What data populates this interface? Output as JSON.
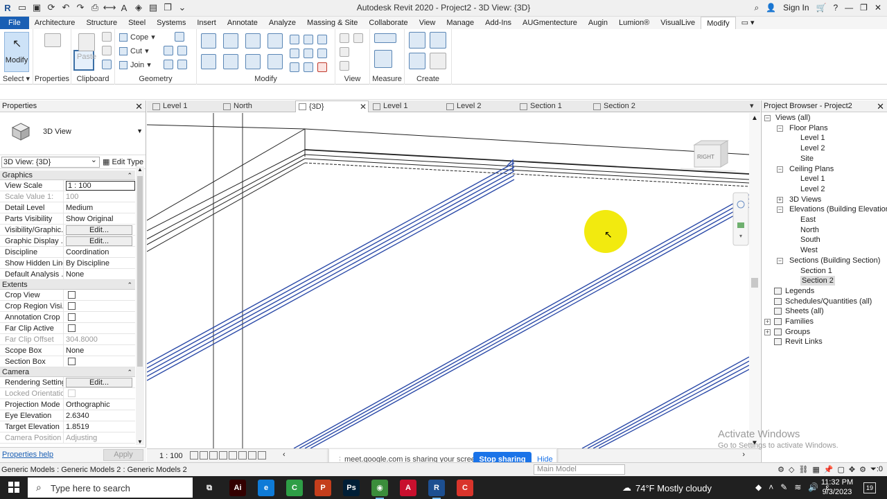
{
  "titlebar": {
    "title": "Autodesk Revit 2020 - Project2 - 3D View: {3D}",
    "sign_in": "Sign In"
  },
  "ribbon_tabs": [
    "File",
    "Architecture",
    "Structure",
    "Steel",
    "Systems",
    "Insert",
    "Annotate",
    "Analyze",
    "Massing & Site",
    "Collaborate",
    "View",
    "Manage",
    "Add-Ins",
    "AUGmentecture",
    "Augin",
    "Lumion®",
    "VisualLive",
    "Modify"
  ],
  "ribbon": {
    "modify_label": "Modify",
    "select_label": "Select",
    "properties_label": "Properties",
    "clipboard_label": "Clipboard",
    "paste_label": "Paste",
    "cope_label": "Cope",
    "cut_label": "Cut",
    "join_label": "Join",
    "geometry_label": "Geometry",
    "modify_group_label": "Modify",
    "view_label": "View",
    "measure_label": "Measure",
    "create_label": "Create"
  },
  "properties": {
    "header": "Properties",
    "type_name": "3D View",
    "selector": "3D View: {3D}",
    "edit_type": "Edit Type",
    "sections": [
      {
        "name": "Graphics",
        "rows": [
          {
            "k": "View Scale",
            "v": "1 : 100",
            "kind": "box"
          },
          {
            "k": "Scale Value    1:",
            "v": "100",
            "kind": "text",
            "disabled": true
          },
          {
            "k": "Detail Level",
            "v": "Medium",
            "kind": "text"
          },
          {
            "k": "Parts Visibility",
            "v": "Show Original",
            "kind": "text"
          },
          {
            "k": "Visibility/Graphic...",
            "v": "Edit...",
            "kind": "edit"
          },
          {
            "k": "Graphic Display ...",
            "v": "Edit...",
            "kind": "edit"
          },
          {
            "k": "Discipline",
            "v": "Coordination",
            "kind": "text"
          },
          {
            "k": "Show Hidden Lines",
            "v": "By Discipline",
            "kind": "text"
          },
          {
            "k": "Default Analysis ...",
            "v": "None",
            "kind": "text"
          }
        ]
      },
      {
        "name": "Extents",
        "rows": [
          {
            "k": "Crop View",
            "v": "",
            "kind": "check"
          },
          {
            "k": "Crop Region Visi...",
            "v": "",
            "kind": "check"
          },
          {
            "k": "Annotation Crop",
            "v": "",
            "kind": "check"
          },
          {
            "k": "Far Clip Active",
            "v": "",
            "kind": "check"
          },
          {
            "k": "Far Clip Offset",
            "v": "304.8000",
            "kind": "text",
            "disabled": true
          },
          {
            "k": "Scope Box",
            "v": "None",
            "kind": "text"
          },
          {
            "k": "Section Box",
            "v": "",
            "kind": "check"
          }
        ]
      },
      {
        "name": "Camera",
        "rows": [
          {
            "k": "Rendering Settings",
            "v": "Edit...",
            "kind": "edit"
          },
          {
            "k": "Locked Orientation",
            "v": "",
            "kind": "check",
            "disabled": true
          },
          {
            "k": "Projection Mode",
            "v": "Orthographic",
            "kind": "text"
          },
          {
            "k": "Eye Elevation",
            "v": "2.6340",
            "kind": "text"
          },
          {
            "k": "Target Elevation",
            "v": "1.8519",
            "kind": "text"
          },
          {
            "k": "Camera Position",
            "v": "Adjusting",
            "kind": "text",
            "disabled": true
          }
        ]
      }
    ],
    "help_link": "Properties help",
    "apply": "Apply"
  },
  "view_tabs": [
    {
      "label": "Level 1",
      "active": false
    },
    {
      "label": "North",
      "active": false
    },
    {
      "label": "{3D}",
      "active": true
    },
    {
      "label": "Level 1",
      "active": false
    },
    {
      "label": "Level 2",
      "active": false
    },
    {
      "label": "Section 1",
      "active": false
    },
    {
      "label": "Section 2",
      "active": false
    }
  ],
  "viewcube_label": "RIGHT",
  "view_bar": {
    "scale": "1 : 100"
  },
  "share_bar": {
    "message": "meet.google.com is sharing your screen.",
    "stop": "Stop sharing",
    "hide": "Hide"
  },
  "project_browser": {
    "header": "Project Browser - Project2",
    "nodes": [
      {
        "label": "Views (all)",
        "level": 0,
        "toggle": "-"
      },
      {
        "label": "Floor Plans",
        "level": 1,
        "toggle": "-"
      },
      {
        "label": "Level 1",
        "level": 2
      },
      {
        "label": "Level 2",
        "level": 2
      },
      {
        "label": "Site",
        "level": 2
      },
      {
        "label": "Ceiling Plans",
        "level": 1,
        "toggle": "-"
      },
      {
        "label": "Level 1",
        "level": 2
      },
      {
        "label": "Level 2",
        "level": 2
      },
      {
        "label": "3D Views",
        "level": 1,
        "toggle": "+"
      },
      {
        "label": "Elevations (Building Elevation)",
        "level": 1,
        "toggle": "-"
      },
      {
        "label": "East",
        "level": 2
      },
      {
        "label": "North",
        "level": 2
      },
      {
        "label": "South",
        "level": 2
      },
      {
        "label": "West",
        "level": 2
      },
      {
        "label": "Sections (Building Section)",
        "level": 1,
        "toggle": "-"
      },
      {
        "label": "Section 1",
        "level": 2
      },
      {
        "label": "Section 2",
        "level": 2,
        "selected": true
      },
      {
        "label": "Legends",
        "level": 0,
        "icon": true
      },
      {
        "label": "Schedules/Quantities (all)",
        "level": 0,
        "icon": true
      },
      {
        "label": "Sheets (all)",
        "level": 0,
        "icon": true
      },
      {
        "label": "Families",
        "level": 0,
        "toggle": "+",
        "icon": true
      },
      {
        "label": "Groups",
        "level": 0,
        "toggle": "+",
        "icon": true
      },
      {
        "label": "Revit Links",
        "level": 0,
        "icon": true
      }
    ]
  },
  "watermark": {
    "line1": "Activate Windows",
    "line2": "Go to Settings to activate Windows."
  },
  "status_bar": {
    "text": "Generic Models : Generic Models 2 : Generic Models 2",
    "model": "Main Model",
    "filter_count": ":0"
  },
  "taskbar": {
    "search_placeholder": "Type here to search",
    "apps": [
      {
        "name": "task-view",
        "label": "⧉",
        "color": "#202020"
      },
      {
        "name": "illustrator",
        "label": "Ai",
        "color": "#330000"
      },
      {
        "name": "edge",
        "label": "e",
        "color": "#0f7bd7"
      },
      {
        "name": "camtasia",
        "label": "C",
        "color": "#2e9e46"
      },
      {
        "name": "powerpoint",
        "label": "P",
        "color": "#c43e1c"
      },
      {
        "name": "photoshop",
        "label": "Ps",
        "color": "#001e36"
      },
      {
        "name": "chrome",
        "label": "◉",
        "color": "#3b8d3b"
      },
      {
        "name": "autocad",
        "label": "A",
        "color": "#c8102e"
      },
      {
        "name": "revit",
        "label": "R",
        "color": "#1d4f91"
      },
      {
        "name": "recorder",
        "label": "C",
        "color": "#d9342b"
      }
    ],
    "weather": "74°F  Mostly cloudy",
    "time": "11:32 PM",
    "date": "9/3/2023",
    "notifications": "19"
  },
  "colors": {
    "accent": "#1a5fb4",
    "beam": "#2b4aa8",
    "pointer": "#f2ea0f"
  }
}
